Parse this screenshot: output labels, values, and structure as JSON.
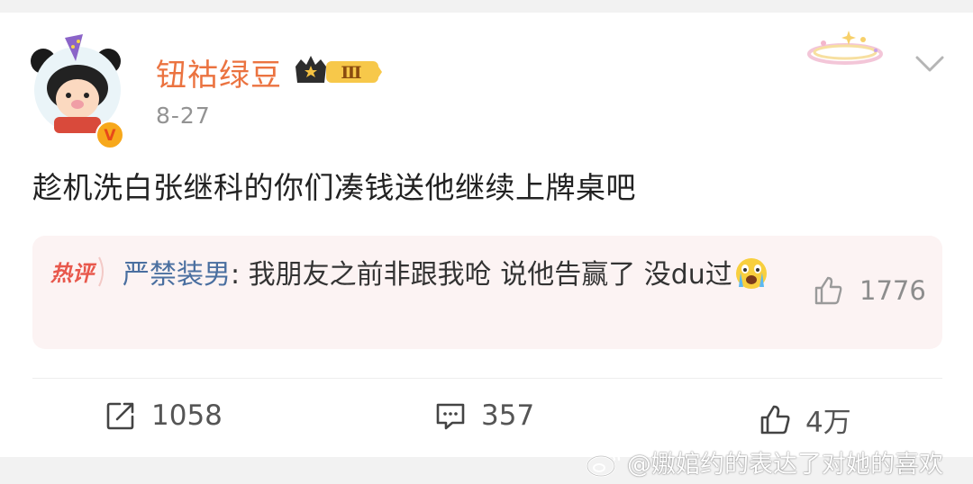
{
  "post": {
    "username": "钮祜绿豆",
    "date": "8-27",
    "text": "趁机洗白张继科的你们凑钱送他继续上牌桌吧",
    "level_badge": "Ⅲ",
    "verified_mark": "V"
  },
  "hot_comment": {
    "label": "热评",
    "user": "严禁装男",
    "text": "我朋友之前非跟我呛 说他告赢了 没du过",
    "emoji": "crying-face",
    "likes": "1776"
  },
  "actions": {
    "repost_count": "1058",
    "comment_count": "357",
    "like_count": "4万"
  },
  "watermark": {
    "text": "@嫐婠约的表达了对她的喜欢"
  },
  "colors": {
    "username": "#eb7340",
    "comment_user": "#4a6fa0",
    "hot_label": "#e8584c",
    "hot_bg": "#fcf3f3"
  }
}
